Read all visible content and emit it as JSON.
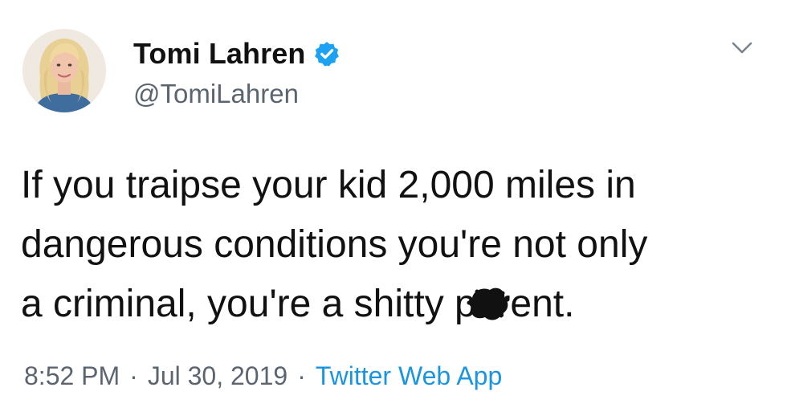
{
  "tweet": {
    "author": {
      "display_name": "Tomi Lahren",
      "handle": "@TomiLahren",
      "verified": true
    },
    "text": "If you traipse your kid 2,000 miles in\ndangerous conditions you're not only\na criminal, you're a shitty parent.",
    "time": "8:52 PM",
    "date": "Jul 30, 2019",
    "separator": "·",
    "source": "Twitter Web App"
  },
  "icons": {
    "verified": "verified-badge-icon",
    "more": "chevron-down-icon"
  },
  "colors": {
    "verified_badge": "#1da1f2",
    "source_link": "#1b95e0",
    "secondary_text": "#5b6570",
    "primary_text": "#111111"
  }
}
